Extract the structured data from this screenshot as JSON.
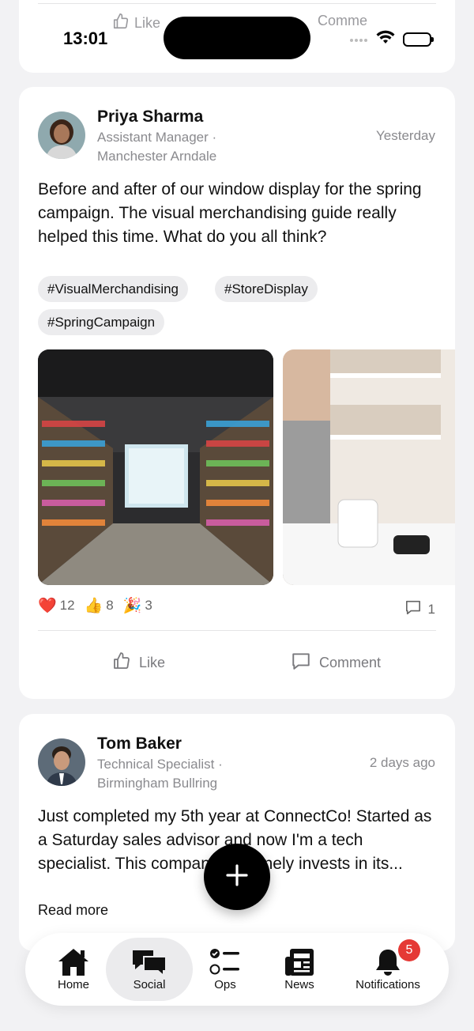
{
  "status_bar": {
    "time": "13:01"
  },
  "top_card": {
    "like_label": "Like",
    "comment_label": "Comme"
  },
  "posts": [
    {
      "author": "Priya Sharma",
      "role": "Assistant Manager ·",
      "location": "Manchester Arndale",
      "time": "Yesterday",
      "text": "Before and after of our window display for the spring campaign. The visual merchandising guide really helped this time. What do you all think?",
      "tags": [
        "#VisualMerchandising",
        "#StoreDisplay",
        "#SpringCampaign"
      ],
      "reactions": [
        {
          "emoji": "❤️",
          "count": "12"
        },
        {
          "emoji": "👍",
          "count": "8"
        },
        {
          "emoji": "🎉",
          "count": "3"
        }
      ],
      "comment_count": "1",
      "like_label": "Like",
      "comment_label": "Comment"
    },
    {
      "author": "Tom Baker",
      "role": "Technical Specialist ·",
      "location": "Birmingham Bullring",
      "time": "2 days ago",
      "text": "Just completed my 5th year at ConnectCo! Started as a Saturday sales advisor and now I'm a tech specialist. This company genuinely invests in its...",
      "read_more": "Read more"
    }
  ],
  "nav": {
    "items": [
      "Home",
      "Social",
      "Ops",
      "News",
      "Notifications"
    ],
    "active": "Social",
    "notifications_badge": "5"
  },
  "colors": {
    "accent": "#000000",
    "badge": "#e53935",
    "background": "#f2f2f4"
  }
}
